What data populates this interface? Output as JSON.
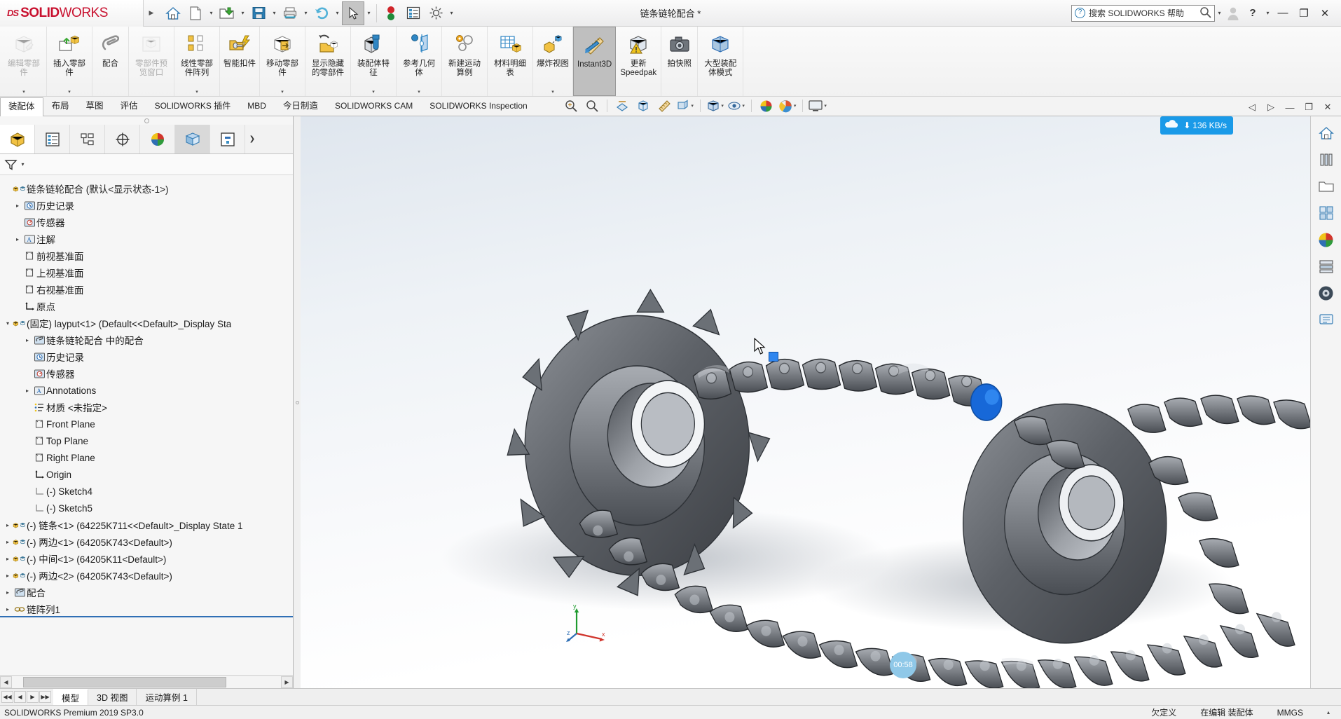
{
  "titlebar": {
    "logo_ds": "DS",
    "logo_solid": "SOLID",
    "logo_works": "WORKS",
    "document_title": "链条链轮配合 *",
    "quick_access": [
      {
        "name": "home-icon",
        "label": "主页"
      },
      {
        "name": "new-document-icon",
        "label": "新建"
      },
      {
        "name": "open-folder-icon",
        "label": "打开"
      },
      {
        "name": "save-icon",
        "label": "保存"
      },
      {
        "name": "print-icon",
        "label": "打印"
      },
      {
        "name": "undo-icon",
        "label": "撤销"
      },
      {
        "name": "select-arrow-icon",
        "label": "选择"
      },
      {
        "name": "rebuild-traffic-light-icon",
        "label": "重建模型"
      },
      {
        "name": "options-list-icon",
        "label": "选项列表"
      },
      {
        "name": "gear-settings-icon",
        "label": "选项"
      }
    ],
    "search_placeholder": "搜索 SOLIDWORKS 帮助",
    "help_label": "?",
    "minimize": "—",
    "restore": "❐",
    "close": "✕"
  },
  "ribbon": {
    "buttons": [
      {
        "label": "编辑零部件",
        "icon": "edit-component-icon",
        "disabled": true,
        "dropdown": true
      },
      {
        "label": "插入零部件",
        "icon": "insert-component-icon",
        "disabled": false,
        "dropdown": true
      },
      {
        "label": "配合",
        "icon": "mate-paperclip-icon",
        "disabled": false,
        "dropdown": false
      },
      {
        "label": "零部件预览窗口",
        "icon": "component-preview-icon",
        "disabled": true,
        "dropdown": false
      },
      {
        "label": "线性零部件阵列",
        "icon": "linear-pattern-icon",
        "disabled": false,
        "dropdown": true
      },
      {
        "label": "智能扣件",
        "icon": "smart-fastener-icon",
        "disabled": false,
        "dropdown": false
      },
      {
        "label": "移动零部件",
        "icon": "move-component-icon",
        "disabled": false,
        "dropdown": true
      },
      {
        "label": "显示隐藏的零部件",
        "icon": "show-hidden-components-icon",
        "disabled": false,
        "dropdown": false
      },
      {
        "label": "装配体特征",
        "icon": "assembly-feature-icon",
        "disabled": false,
        "dropdown": true
      },
      {
        "label": "参考几何体",
        "icon": "reference-geometry-icon",
        "disabled": false,
        "dropdown": true
      },
      {
        "label": "新建运动算例",
        "icon": "new-motion-study-icon",
        "disabled": false,
        "dropdown": false
      },
      {
        "label": "材料明细表",
        "icon": "bill-of-materials-icon",
        "disabled": false,
        "dropdown": false
      },
      {
        "label": "爆炸视图",
        "icon": "exploded-view-icon",
        "disabled": false,
        "dropdown": true
      },
      {
        "label": "Instant3D",
        "icon": "instant3d-icon",
        "disabled": false,
        "dropdown": false,
        "active": true
      },
      {
        "label": "更新 Speedpak",
        "icon": "update-speedpak-icon",
        "disabled": false,
        "dropdown": false
      },
      {
        "label": "拍快照",
        "icon": "take-snapshot-icon",
        "disabled": false,
        "dropdown": false
      },
      {
        "label": "大型装配体模式",
        "icon": "large-assembly-mode-icon",
        "disabled": false,
        "dropdown": false
      }
    ]
  },
  "command_tabs": {
    "items": [
      {
        "label": "装配体",
        "active": true
      },
      {
        "label": "布局",
        "active": false
      },
      {
        "label": "草图",
        "active": false
      },
      {
        "label": "评估",
        "active": false
      },
      {
        "label": "SOLIDWORKS 插件",
        "active": false
      },
      {
        "label": "MBD",
        "active": false
      },
      {
        "label": "今日制造",
        "active": false
      },
      {
        "label": "SOLIDWORKS CAM",
        "active": false
      },
      {
        "label": "SOLIDWORKS Inspection",
        "active": false
      }
    ],
    "view_tools": [
      {
        "name": "zoom-to-fit-icon"
      },
      {
        "name": "zoom-area-icon"
      },
      {
        "name": "section-view-icon"
      },
      {
        "name": "view-orientation-cube-icon"
      },
      {
        "name": "measure-icon"
      },
      {
        "name": "display-style-icon",
        "dropdown": true
      },
      {
        "name": "view-orientation-icon",
        "dropdown": true
      },
      {
        "name": "hide-show-items-icon",
        "dropdown": true
      },
      {
        "name": "appearances-icon"
      },
      {
        "name": "scene-icon",
        "dropdown": true
      },
      {
        "name": "viewport-layout-icon",
        "dropdown": true
      }
    ],
    "doc_window_buttons": [
      {
        "name": "panel-left-icon",
        "glyph": "◁"
      },
      {
        "name": "panel-right-icon",
        "glyph": "▷"
      },
      {
        "name": "doc-minimize-icon",
        "glyph": "—"
      },
      {
        "name": "doc-restore-icon",
        "glyph": "❐"
      },
      {
        "name": "doc-close-icon",
        "glyph": "✕"
      }
    ]
  },
  "left_panel": {
    "tabs": [
      {
        "name": "feature-manager-tab",
        "active": true
      },
      {
        "name": "property-manager-tab",
        "active": false
      },
      {
        "name": "configuration-manager-tab",
        "active": false
      },
      {
        "name": "dimxpert-manager-tab",
        "active": false
      },
      {
        "name": "display-manager-tab",
        "active": false
      },
      {
        "name": "appearances-manager-tab",
        "active": false,
        "shaded": true
      },
      {
        "name": "render-manager-tab",
        "active": false
      },
      {
        "name": "more-tabs-button",
        "active": false
      }
    ],
    "filter_label": "过滤器",
    "tree": [
      {
        "indent": 0,
        "twisty": "",
        "icon": "assembly-root-icon",
        "label": "链条链轮配合  (默认<显示状态-1>)"
      },
      {
        "indent": 1,
        "twisty": "▸",
        "icon": "history-icon",
        "label": "历史记录"
      },
      {
        "indent": 1,
        "twisty": "",
        "icon": "sensors-icon",
        "label": "传感器"
      },
      {
        "indent": 1,
        "twisty": "▸",
        "icon": "annotations-icon",
        "label": "注解"
      },
      {
        "indent": 1,
        "twisty": "",
        "icon": "plane-icon",
        "label": "前视基准面"
      },
      {
        "indent": 1,
        "twisty": "",
        "icon": "plane-icon",
        "label": "上视基准面"
      },
      {
        "indent": 1,
        "twisty": "",
        "icon": "plane-icon",
        "label": "右视基准面"
      },
      {
        "indent": 1,
        "twisty": "",
        "icon": "origin-icon",
        "label": "原点"
      },
      {
        "indent": 0,
        "twisty": "▾",
        "icon": "part-icon",
        "label": "(固定) layput<1> (Default<<Default>_Display Sta"
      },
      {
        "indent": 2,
        "twisty": "▸",
        "icon": "mates-folder-icon",
        "label": "链条链轮配合 中的配合"
      },
      {
        "indent": 2,
        "twisty": "",
        "icon": "history-icon",
        "label": "历史记录"
      },
      {
        "indent": 2,
        "twisty": "",
        "icon": "sensors-icon",
        "label": "传感器"
      },
      {
        "indent": 2,
        "twisty": "▸",
        "icon": "annotations-icon",
        "label": "Annotations"
      },
      {
        "indent": 2,
        "twisty": "",
        "icon": "material-icon",
        "label": "材质 <未指定>"
      },
      {
        "indent": 2,
        "twisty": "",
        "icon": "plane-icon",
        "label": "Front Plane"
      },
      {
        "indent": 2,
        "twisty": "",
        "icon": "plane-icon",
        "label": "Top Plane"
      },
      {
        "indent": 2,
        "twisty": "",
        "icon": "plane-icon",
        "label": "Right Plane"
      },
      {
        "indent": 2,
        "twisty": "",
        "icon": "origin-icon",
        "label": "Origin"
      },
      {
        "indent": 2,
        "twisty": "",
        "icon": "sketch-icon",
        "label": "(-) Sketch4"
      },
      {
        "indent": 2,
        "twisty": "",
        "icon": "sketch-icon",
        "label": "(-) Sketch5"
      },
      {
        "indent": 0,
        "twisty": "▸",
        "icon": "part-icon",
        "label": "(-) 链条<1> (64225K711<<Default>_Display State 1"
      },
      {
        "indent": 0,
        "twisty": "▸",
        "icon": "part-icon",
        "label": "(-) 两边<1> (64205K743<Default>)"
      },
      {
        "indent": 0,
        "twisty": "▸",
        "icon": "part-icon",
        "label": "(-) 中间<1> (64205K11<Default>)"
      },
      {
        "indent": 0,
        "twisty": "▸",
        "icon": "part-icon",
        "label": "(-) 两边<2> (64205K743<Default>)"
      },
      {
        "indent": 0,
        "twisty": "▸",
        "icon": "mates-folder-icon",
        "label": "配合"
      },
      {
        "indent": 0,
        "twisty": "▸",
        "icon": "chain-pattern-icon",
        "label": "链阵列1"
      }
    ]
  },
  "right_toolbar": {
    "buttons": [
      {
        "name": "view-home-icon"
      },
      {
        "name": "view-library-icon"
      },
      {
        "name": "file-explorer-icon"
      },
      {
        "name": "view-palette-icon"
      },
      {
        "name": "appearances-sphere-icon"
      },
      {
        "name": "scenes-lights-icon"
      },
      {
        "name": "decals-icon"
      },
      {
        "name": "custom-properties-icon"
      }
    ]
  },
  "viewport": {
    "network_badge": "136 KB/s",
    "network_icon": "cloud-download-icon",
    "timer_label": "00:58",
    "triad_x": "x",
    "triad_y": "y",
    "triad_z": "z",
    "model_description": "链条链轮装配体三维视图"
  },
  "bottom_tabs": {
    "nav": [
      "◀◀",
      "◀",
      "▶",
      "▶▶"
    ],
    "items": [
      {
        "label": "模型",
        "active": true
      },
      {
        "label": "3D 视图",
        "active": false
      },
      {
        "label": "运动算例 1",
        "active": false
      }
    ]
  },
  "statusbar": {
    "version": "SOLIDWORKS Premium 2019 SP3.0",
    "constraint_status": "欠定义",
    "edit_status": "在编辑 装配体",
    "units": "MMGS",
    "units_caret": "▴"
  }
}
